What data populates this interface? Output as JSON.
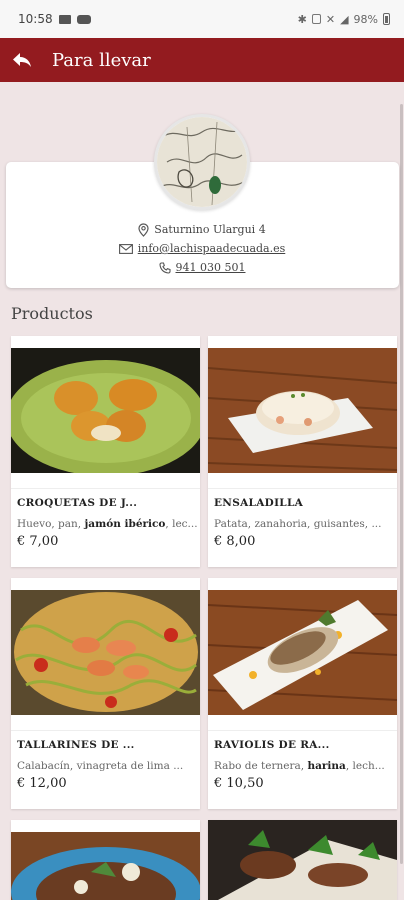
{
  "status": {
    "time": "10:58",
    "battery": "98%"
  },
  "appbar": {
    "title": "Para llevar"
  },
  "store": {
    "address": "Saturnino Ulargui 4",
    "email": "info@lachispaadecuada.es",
    "phone": "941 030 501"
  },
  "section": {
    "title": "Productos"
  },
  "products": [
    {
      "name": "CROQUETAS DE J...",
      "desc_pre": "Huevo, pan, ",
      "desc_bold": "jamón ibérico",
      "desc_post": ", lec...",
      "price": "€ 7,00"
    },
    {
      "name": "ENSALADILLA",
      "desc_pre": "Patata, zanahoria, guisantes, ...",
      "desc_bold": "",
      "desc_post": "",
      "price": "€ 8,00"
    },
    {
      "name": "TALLARINES DE ...",
      "desc_pre": "Calabacín, vinagreta de lima ...",
      "desc_bold": "",
      "desc_post": "",
      "price": "€ 12,00"
    },
    {
      "name": "RAVIOLIS DE RA...",
      "desc_pre": "Rabo de ternera, ",
      "desc_bold": "harina",
      "desc_post": ", lech...",
      "price": "€ 10,50"
    }
  ],
  "colors": {
    "brand": "#931b1f",
    "background": "#efe4e5"
  },
  "icons": [
    "back-arrow-icon",
    "location-pin-icon",
    "envelope-icon",
    "phone-icon"
  ]
}
